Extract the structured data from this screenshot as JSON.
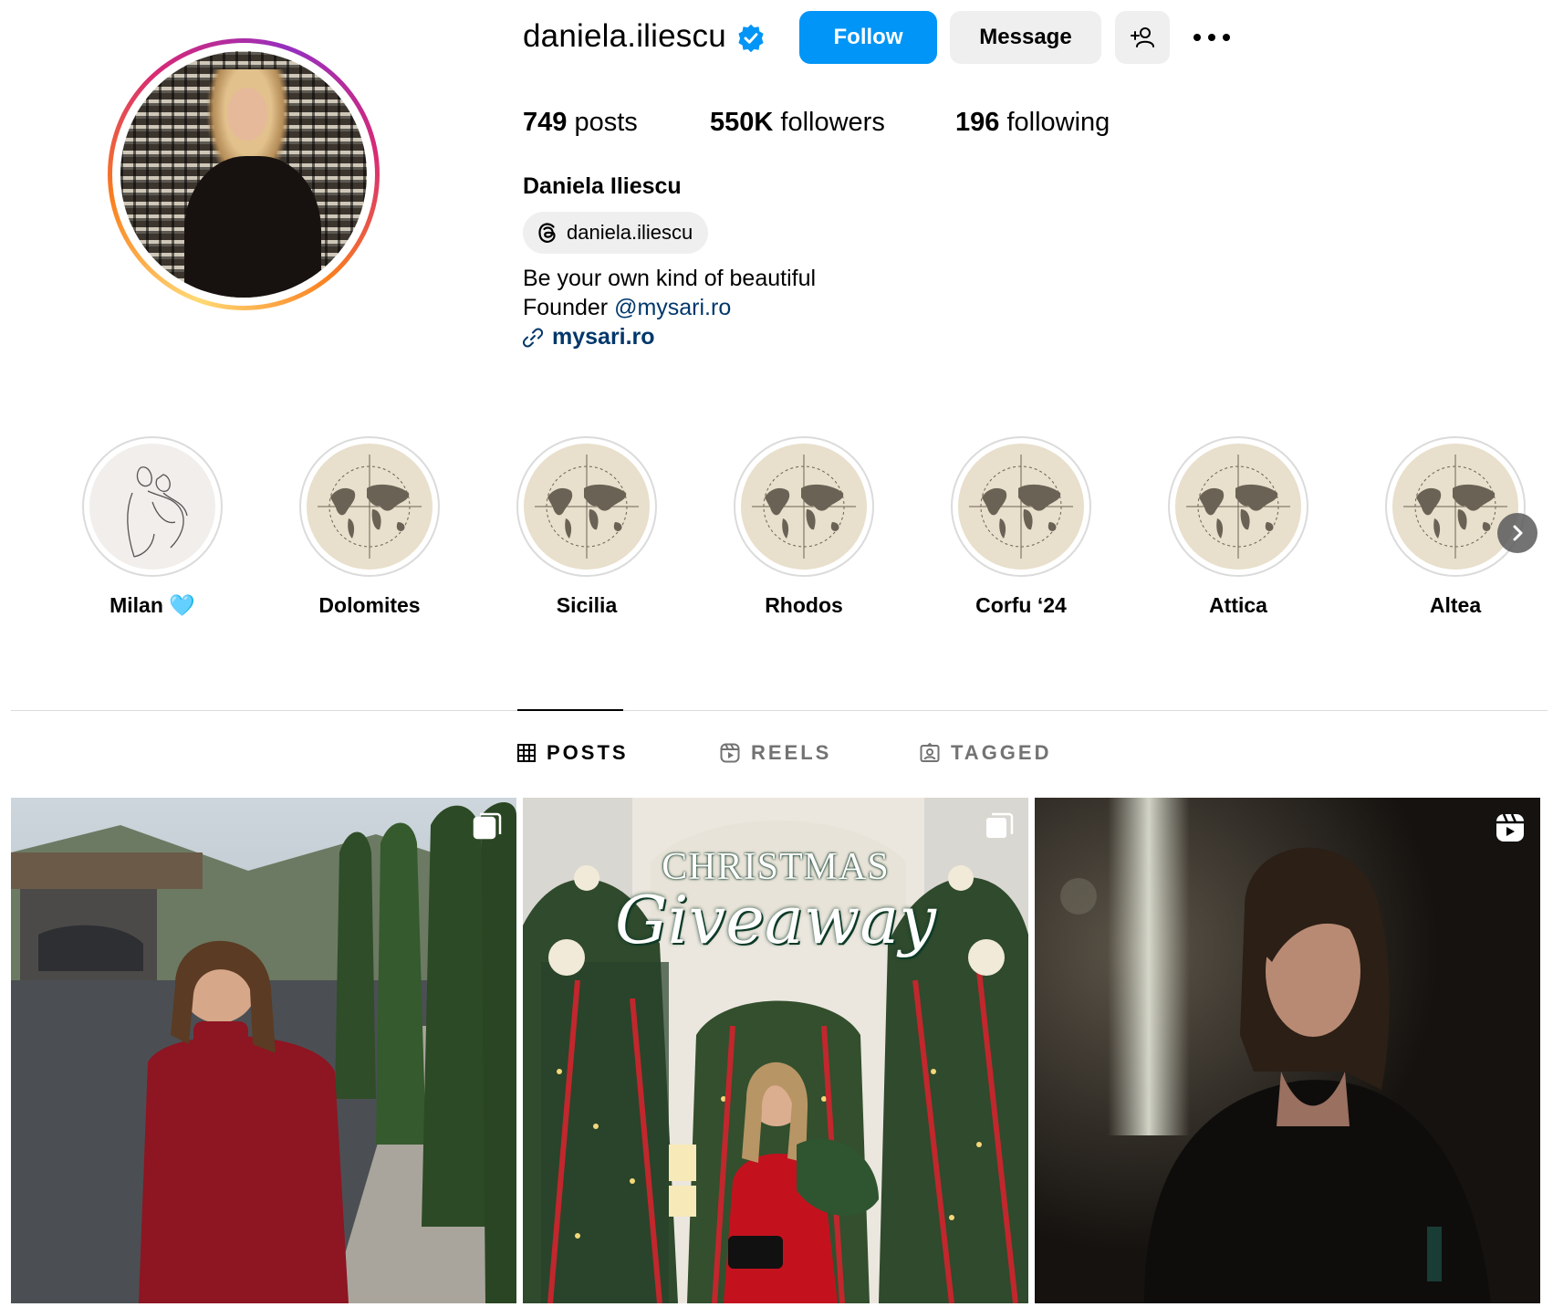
{
  "profile": {
    "username": "daniela.iliescu",
    "verified": true,
    "follow_label": "Follow",
    "message_label": "Message",
    "stats": {
      "posts_count": "749",
      "posts_label": "posts",
      "followers_count": "550K",
      "followers_label": "followers",
      "following_count": "196",
      "following_label": "following"
    },
    "full_name": "Daniela Iliescu",
    "threads_handle": "daniela.iliescu",
    "bio_line1": "Be your own kind of beautiful",
    "bio_line2_prefix": "Founder ",
    "bio_mention": "@mysari.ro",
    "link_text": "mysari.ro"
  },
  "highlights": [
    {
      "label": "Milan 🩵",
      "icon": "couple-sketch"
    },
    {
      "label": "Dolomites",
      "icon": "world-map"
    },
    {
      "label": "Sicilia",
      "icon": "world-map"
    },
    {
      "label": "Rhodos",
      "icon": "world-map"
    },
    {
      "label": "Corfu ‘24",
      "icon": "world-map"
    },
    {
      "label": "Attica",
      "icon": "world-map"
    },
    {
      "label": "Altea",
      "icon": "world-map"
    }
  ],
  "tabs": [
    {
      "label": "POSTS",
      "icon": "grid-icon",
      "active": true
    },
    {
      "label": "REELS",
      "icon": "reels-icon",
      "active": false
    },
    {
      "label": "TAGGED",
      "icon": "tagged-icon",
      "active": false
    }
  ],
  "posts": [
    {
      "type": "carousel",
      "badge_icon": "carousel-icon",
      "overlay_text": ""
    },
    {
      "type": "carousel",
      "badge_icon": "carousel-icon",
      "overlay_title": "CHRISTMAS",
      "overlay_script": "Giveaway"
    },
    {
      "type": "reel",
      "badge_icon": "reel-icon",
      "overlay_text": ""
    }
  ],
  "colors": {
    "follow_button": "#0095f6",
    "secondary_button": "#efefef",
    "link": "#00376b",
    "verified_badge": "#0095f6",
    "highlight_bg": "#e8dfcc"
  }
}
